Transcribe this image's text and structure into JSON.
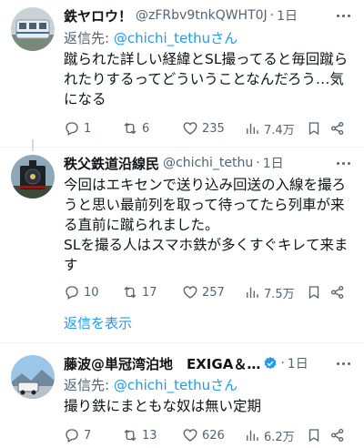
{
  "tweets": [
    {
      "name": "鉄ヤロウ！",
      "handle": "@zFRbv9tnkQWHT0J",
      "dot": "·",
      "time": "1日",
      "reply_prefix": "返信先: ",
      "reply_to": "@chichi_tethuさん",
      "text": "蹴られた詳しい経緯とSL撮ってると毎回蹴られたりするってどういうことなんだろう…気になる",
      "replies": "1",
      "retweets": "6",
      "likes": "235",
      "views": "7.4万"
    },
    {
      "name": "秩父鉄道沿線民",
      "handle": "@chichi_tethu",
      "dot": "·",
      "time": "1日",
      "text_p1": "今回はエキセンで送り込み回送の入線を撮ろうと思い最前列を取って待ってたら列車が来る直前に蹴られました。",
      "text_p2": "SLを撮る人はスマホ鉄が多くすぐキレて来ます",
      "replies": "10",
      "retweets": "17",
      "likes": "257",
      "views": "7.5万"
    },
    {
      "name": "藤波@単冠湾泊地　EXIGA＆…",
      "dot": "·",
      "time": "1日",
      "reply_prefix": "返信先: ",
      "reply_to": "@chichi_tethuさん",
      "text": "撮り鉄にまともな奴は無い定期",
      "replies": "7",
      "retweets": "13",
      "likes": "626",
      "views": "6.2万"
    }
  ],
  "show_replies": "返信を表示",
  "colors": {
    "accent": "#1d9bf0",
    "secondary_text": "#536471",
    "primary_text": "#0f1419"
  }
}
